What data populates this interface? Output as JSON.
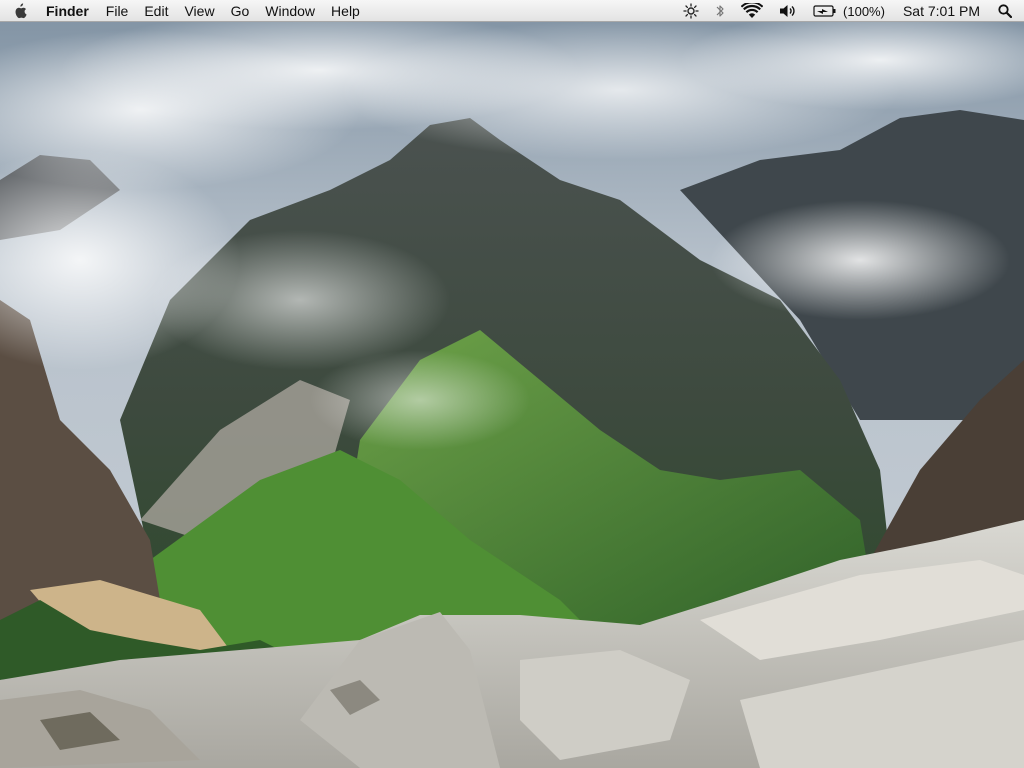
{
  "menubar": {
    "apple_icon": "apple-icon",
    "app_name": "Finder",
    "menus": [
      "File",
      "Edit",
      "View",
      "Go",
      "Window",
      "Help"
    ],
    "extras": {
      "brightness_icon": "sun-icon",
      "bluetooth_icon": "bluetooth-icon",
      "wifi_icon": "wifi-icon",
      "volume_icon": "speaker-icon",
      "battery_icon": "battery-charging-icon",
      "battery_percent": "(100%)",
      "clock": "Sat 7:01 PM",
      "spotlight_icon": "magnifier-icon"
    }
  },
  "desktop": {
    "wallpaper": "mountain-landscape-with-clouds"
  },
  "colors": {
    "menubar_top": "#f6f6f6",
    "menubar_bottom": "#e3e3e3",
    "menubar_text": "#111111"
  }
}
